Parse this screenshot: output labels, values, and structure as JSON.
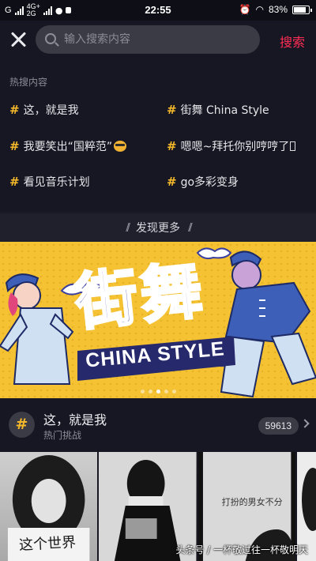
{
  "status_bar": {
    "signal1_label": "G",
    "net_top": "4G+",
    "net_bottom": "2G",
    "time": "22:55",
    "battery": "83%"
  },
  "search": {
    "placeholder": "输入搜索内容",
    "submit_label": "搜索"
  },
  "hot": {
    "title": "热搜内容",
    "items": [
      {
        "label": "这，就是我"
      },
      {
        "label": "街舞 China Style"
      },
      {
        "label": "我要笑出“国粹范”"
      },
      {
        "label": "嗯嗯~拜托你别哼哼了"
      },
      {
        "label": "看见音乐计划"
      },
      {
        "label": "go多彩变身"
      }
    ],
    "hash_symbol": "#",
    "more_label": "发现更多"
  },
  "banner": {
    "headline_cn": "街舞",
    "headline_en": "CHINA STYLE",
    "bg_color": "#f4c232",
    "slide_count": 5,
    "active_slide": 3
  },
  "challenge": {
    "title": "这，就是我",
    "subtitle": "热门挑战",
    "count": "59613"
  },
  "thumbs": {
    "t1_caption": "这个世界",
    "t3_caption": "打扮的男女不分",
    "watermark": "头条号 / 一杯敬过往一杯敬明天"
  },
  "colors": {
    "accent_red": "#ff2d55",
    "hash_yellow": "#f4b82a",
    "background": "#161722"
  }
}
